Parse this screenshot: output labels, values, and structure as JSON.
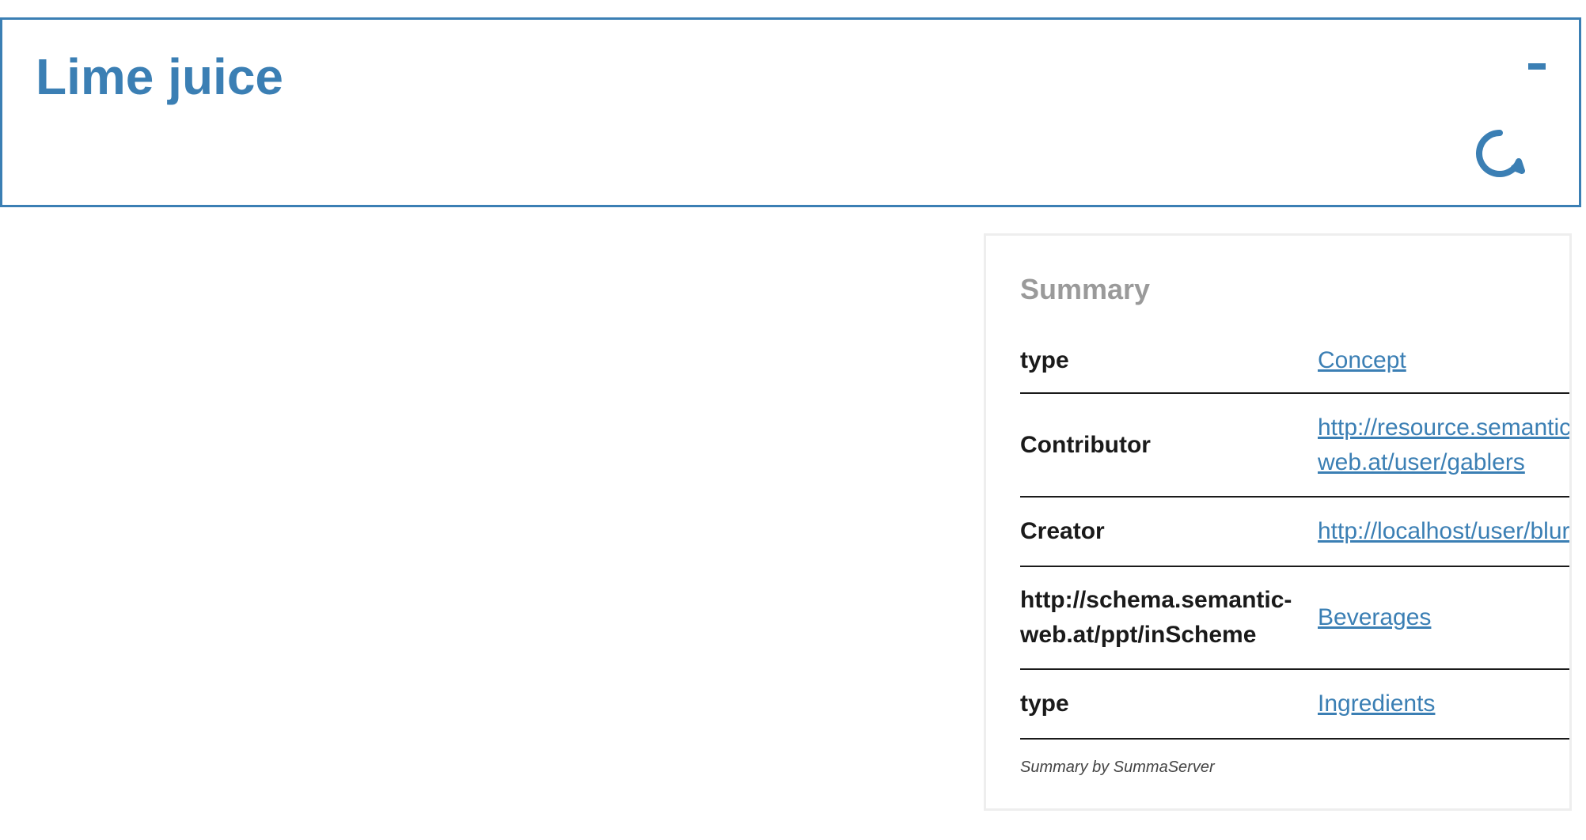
{
  "header": {
    "title": "Lime juice",
    "collapse_label": "-",
    "accent_color": "#3b7fb4",
    "chat_icon": "chat-bubble-icon"
  },
  "summary": {
    "heading": "Summary",
    "rows": [
      {
        "property": "type",
        "value": "Concept"
      },
      {
        "property": "Contributor",
        "value_line1": "http://resource.semantic-",
        "value_line2": "web.at/user/gablers"
      },
      {
        "property": "Creator",
        "value": "http://localhost/user/blur"
      },
      {
        "property_line1": "http://schema.semantic-",
        "property_line2": "web.at/ppt/inScheme",
        "value": "Beverages"
      },
      {
        "property": "type",
        "value": "Ingredients"
      }
    ],
    "footer": "Summary by SummaServer"
  }
}
